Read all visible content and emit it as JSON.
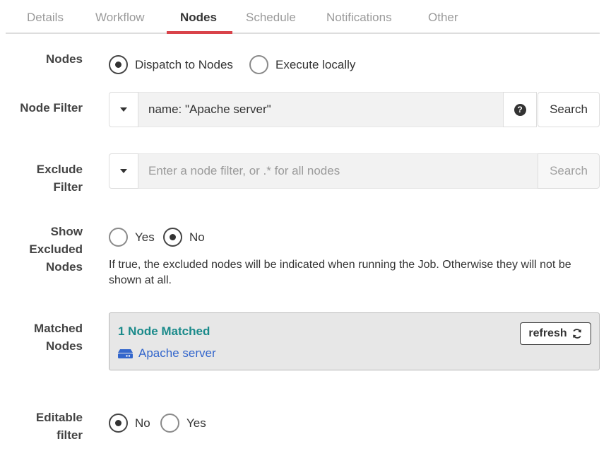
{
  "tabs": [
    {
      "label": "Details"
    },
    {
      "label": "Workflow"
    },
    {
      "label": "Nodes"
    },
    {
      "label": "Schedule"
    },
    {
      "label": "Notifications"
    },
    {
      "label": "Other"
    }
  ],
  "active_tab": "Nodes",
  "nodes": {
    "label": "Nodes",
    "options": [
      "Dispatch to Nodes",
      "Execute locally"
    ],
    "selected": "Dispatch to Nodes"
  },
  "node_filter": {
    "label": "Node Filter",
    "value": "name: \"Apache server\"",
    "search_label": "Search"
  },
  "exclude_filter": {
    "label_line1": "Exclude",
    "label_line2": "Filter",
    "placeholder": "Enter a node filter, or .* for all nodes",
    "search_label": "Search"
  },
  "show_excluded": {
    "label_line1": "Show",
    "label_line2": "Excluded",
    "label_line3": "Nodes",
    "options": [
      "Yes",
      "No"
    ],
    "selected": "No",
    "help": "If true, the excluded nodes will be indicated when running the Job. Otherwise they will not be shown at all."
  },
  "matched_nodes": {
    "label_line1": "Matched",
    "label_line2": "Nodes",
    "count_text": "1 Node Matched",
    "nodes": [
      "Apache server"
    ],
    "refresh_label": "refresh"
  },
  "editable_filter": {
    "label_line1": "Editable",
    "label_line2": "filter",
    "options": [
      "No",
      "Yes"
    ],
    "selected": "No"
  },
  "colors": {
    "accent": "#d9434a",
    "matched_text": "#1a8a8a",
    "link": "#3366cc"
  }
}
